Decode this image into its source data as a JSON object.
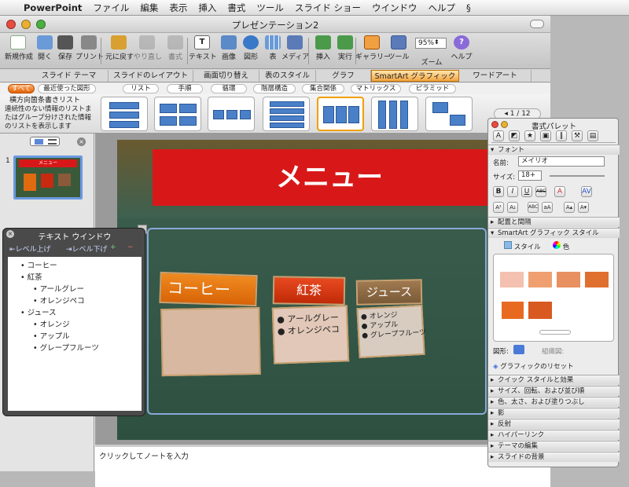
{
  "menubar": {
    "app": "PowerPoint",
    "items": [
      "ファイル",
      "編集",
      "表示",
      "挿入",
      "書式",
      "ツール",
      "スライド ショー",
      "ウインドウ",
      "ヘルプ"
    ]
  },
  "window": {
    "title": "プレゼンテーション2"
  },
  "toolbar": {
    "buttons": [
      "新規作成",
      "開く",
      "保存",
      "プリント",
      "元に戻す",
      "やり直し",
      "書式",
      "テキスト",
      "画像",
      "図形",
      "表",
      "メディア",
      "挿入",
      "実行",
      "ギャラリー",
      "ツール",
      "ズーム",
      "ヘルプ"
    ],
    "zoom": "95%"
  },
  "ribbon": {
    "tabs": [
      "スライド テーマ",
      "スライドのレイアウト",
      "画面切り替え",
      "表のスタイル",
      "グラフ",
      "SmartArt グラフィック",
      "ワードアート"
    ],
    "active_tab": "SmartArt グラフィック",
    "categories": [
      "すべて",
      "最近使った図形",
      "リスト",
      "手順",
      "循環",
      "階層構造",
      "集合関係",
      "マトリックス",
      "ピラミッド"
    ],
    "gallery_name": "横方向箇条書きリスト",
    "gallery_desc": "連続性のない情報のリストまたはグループ分けされた情報のリストを表示します",
    "page": "1 / 12"
  },
  "slides": {
    "number": "1",
    "thumb_title": "メニュー"
  },
  "slide": {
    "title": "メニュー",
    "cards": [
      {
        "header": "コーヒー",
        "items": []
      },
      {
        "header": "紅茶",
        "items": [
          "アールグレー",
          "オレンジペコ"
        ]
      },
      {
        "header": "ジュース",
        "items": [
          "オレンジ",
          "アップル",
          "グレープフルーツ"
        ]
      }
    ]
  },
  "notes": {
    "placeholder": "クリックしてノートを入力"
  },
  "text_window": {
    "title": "テキスト ウインドウ",
    "level_up": "レベル上げ",
    "level_down": "レベル下げ",
    "bullets": [
      {
        "text": "コーヒー",
        "level": 1
      },
      {
        "text": "紅茶",
        "level": 1
      },
      {
        "text": "アールグレー",
        "level": 2
      },
      {
        "text": "オレンジペコ",
        "level": 2
      },
      {
        "text": "ジュース",
        "level": 1
      },
      {
        "text": "オレンジ",
        "level": 2
      },
      {
        "text": "アップル",
        "level": 2
      },
      {
        "text": "グレープフルーツ",
        "level": 2
      }
    ]
  },
  "palette": {
    "title": "書式パレット",
    "font_section": "フォント",
    "name_label": "名前:",
    "font_name": "メイリオ",
    "size_label": "サイズ:",
    "font_size": "18+",
    "align_section": "配置と間隔",
    "smartart_section": "SmartArt グラフィック スタイル",
    "style_tab": "スタイル",
    "color_tab": "色",
    "shape_label": "図形:",
    "org_label": "組織図:",
    "reset": "グラフィックのリセット",
    "sections": [
      "クイック スタイルと効果",
      "サイズ、回転、および並び順",
      "色、太さ、および塗りつぶし",
      "影",
      "反射",
      "ハイパーリンク",
      "テーマの編集",
      "スライドの背景"
    ]
  },
  "colors": {
    "accent": "#f4a640",
    "slide_bg": "#3d6050",
    "banner": "#d81818"
  }
}
